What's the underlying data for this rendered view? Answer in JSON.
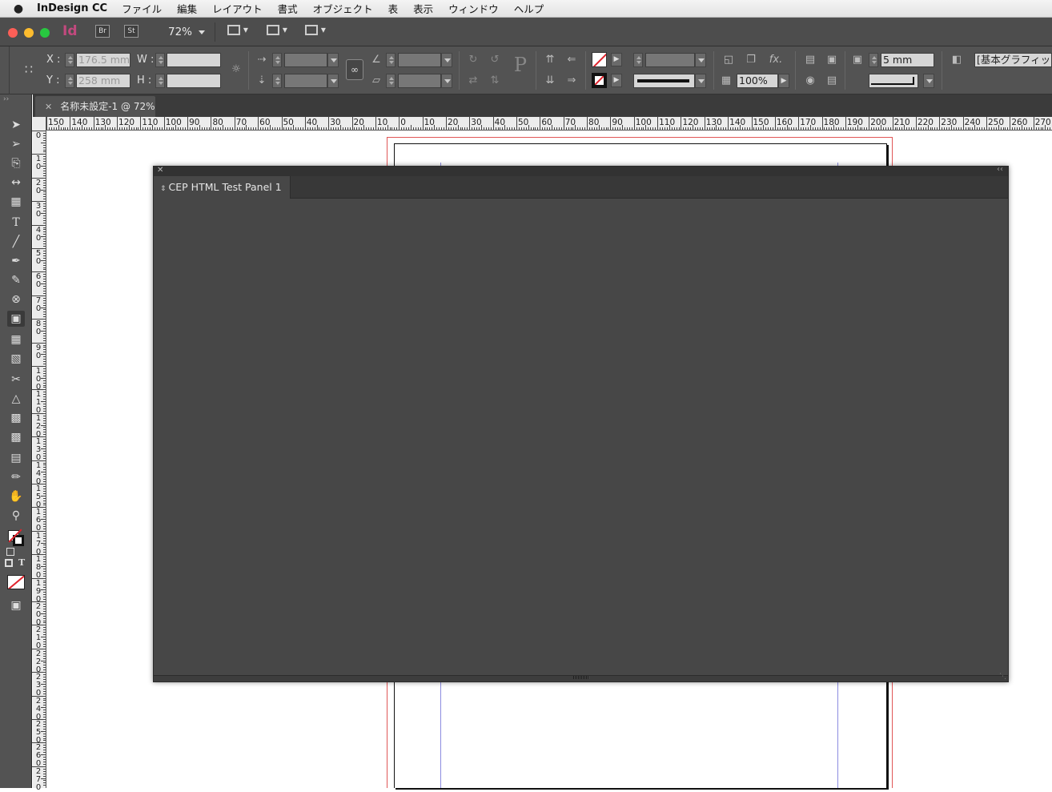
{
  "menubar": {
    "apple": "",
    "app_name": "InDesign CC",
    "items": [
      "ファイル",
      "編集",
      "レイアウト",
      "書式",
      "オブジェクト",
      "表",
      "表示",
      "ウィンドウ",
      "ヘルプ"
    ]
  },
  "appbar": {
    "app_icon": "Id",
    "bridge_label": "Br",
    "stock_label": "St",
    "zoom": "72%"
  },
  "control": {
    "x_label": "X :",
    "y_label": "Y :",
    "w_label": "W :",
    "h_label": "H :",
    "x_value": "176.5 mm",
    "y_value": "258 mm",
    "opacity": "100%",
    "stroke_offset": "5 mm",
    "object_style": "[基本グラフィック"
  },
  "document_tab": {
    "title": "名称未設定-1 @ 72%"
  },
  "ruler": {
    "h_labels": [
      "150",
      "140",
      "130",
      "120",
      "110",
      "100",
      "90",
      "80",
      "70",
      "60",
      "50",
      "40",
      "30",
      "20",
      "10",
      "0",
      "10",
      "20",
      "30",
      "40",
      "50",
      "60",
      "70",
      "80",
      "90",
      "100",
      "110",
      "120",
      "130",
      "140",
      "150",
      "160",
      "170",
      "180",
      "190",
      "200",
      "210",
      "220",
      "230",
      "240",
      "250",
      "260",
      "270"
    ],
    "v_labels": [
      "0",
      "10",
      "20",
      "30",
      "40",
      "50",
      "60",
      "70",
      "80",
      "90",
      "100",
      "110",
      "120",
      "130",
      "140",
      "150",
      "160",
      "170",
      "180",
      "190",
      "200",
      "210",
      "220",
      "230",
      "240",
      "250",
      "260",
      "270"
    ]
  },
  "cep_panel": {
    "tab_label": "CEP HTML Test Panel 1"
  },
  "colors": {
    "app_icon": "#c2497e",
    "panel_bg": "#474747",
    "ui_bg": "#535353",
    "bleed_guide": "#e05656",
    "margin_guide": "#8c8ce0"
  }
}
